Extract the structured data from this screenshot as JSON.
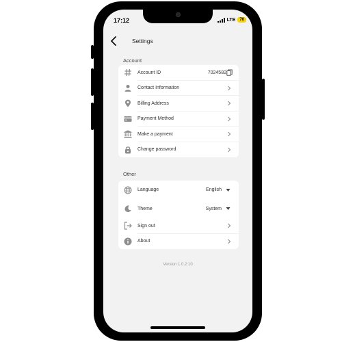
{
  "status_bar": {
    "time": "17:12",
    "network": "LTE",
    "battery": "70",
    "battery_color": "#f5d20a"
  },
  "header": {
    "title": "Settings",
    "back_icon": "chevron-left-icon"
  },
  "account_section": {
    "heading": "Account",
    "items": [
      {
        "label": "Account ID",
        "value": "7024582",
        "icon": "hash-icon",
        "trailing": "copy-icon"
      },
      {
        "label": "Contact Information",
        "icon": "person-icon",
        "trailing": "chevron-right-icon"
      },
      {
        "label": "Billing Address",
        "icon": "location-pin-icon",
        "trailing": "chevron-right-icon"
      },
      {
        "label": "Payment Method",
        "icon": "credit-card-icon",
        "trailing": "chevron-right-icon"
      },
      {
        "label": "Make a payment",
        "icon": "bank-icon",
        "trailing": "chevron-right-icon"
      },
      {
        "label": "Change password",
        "icon": "lock-icon",
        "trailing": "chevron-right-icon"
      }
    ]
  },
  "other_section": {
    "heading": "Other",
    "items": [
      {
        "label": "Language",
        "value": "English",
        "icon": "globe-icon",
        "trailing": "caret-down-icon"
      },
      {
        "label": "Theme",
        "value": "System",
        "icon": "moon-icon",
        "trailing": "caret-down-icon"
      },
      {
        "label": "Sign out",
        "icon": "sign-out-icon",
        "trailing": "chevron-right-icon"
      },
      {
        "label": "About",
        "icon": "info-icon",
        "trailing": "chevron-right-icon"
      }
    ]
  },
  "footer": {
    "version": "Version 1.0.2:10"
  }
}
